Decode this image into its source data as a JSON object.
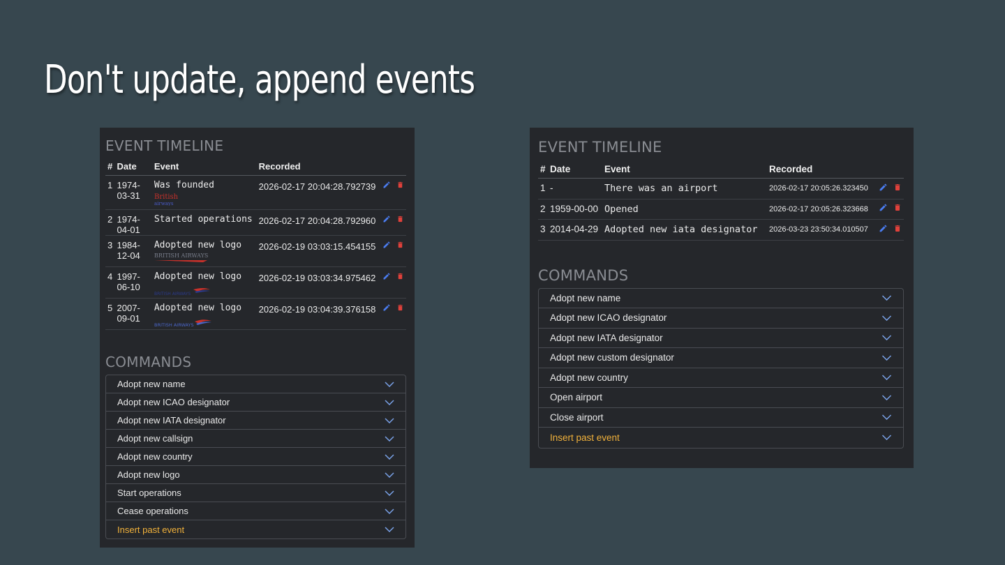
{
  "slide": {
    "title": "Don't update, append events"
  },
  "left_panel": {
    "timeline_heading": "EVENT TIMELINE",
    "columns": {
      "num": "#",
      "date": "Date",
      "event": "Event",
      "recorded": "Recorded"
    },
    "rows": [
      {
        "num": "1",
        "date": "1974-03-31",
        "event": "Was founded",
        "recorded": "2026-02-17 20:04:28.792739",
        "logo": "British airways",
        "logo_word1": "British",
        "logo_word2": "airways"
      },
      {
        "num": "2",
        "date": "1974-04-01",
        "event": "Started operations",
        "recorded": "2026-02-17 20:04:28.792960"
      },
      {
        "num": "3",
        "date": "1984-12-04",
        "event": "Adopted new logo",
        "recorded": "2026-02-19 03:03:15.454155",
        "logo": "BRITISH AIRWAYS"
      },
      {
        "num": "4",
        "date": "1997-06-10",
        "event": "Adopted new logo",
        "recorded": "2026-02-19 03:03:34.975462",
        "logo": "BRITISH AIRWAYS"
      },
      {
        "num": "5",
        "date": "2007-09-01",
        "event": "Adopted new logo",
        "recorded": "2026-02-19 03:04:39.376158",
        "logo": "BRITISH AIRWAYS"
      }
    ],
    "commands_heading": "COMMANDS",
    "commands": [
      {
        "label": "Adopt new name"
      },
      {
        "label": "Adopt new ICAO designator"
      },
      {
        "label": "Adopt new IATA designator"
      },
      {
        "label": "Adopt new callsign"
      },
      {
        "label": "Adopt new country"
      },
      {
        "label": "Adopt new logo"
      },
      {
        "label": "Start operations"
      },
      {
        "label": "Cease operations"
      },
      {
        "label": "Insert past event"
      }
    ]
  },
  "right_panel": {
    "timeline_heading": "EVENT TIMELINE",
    "columns": {
      "num": "#",
      "date": "Date",
      "event": "Event",
      "recorded": "Recorded"
    },
    "rows": [
      {
        "num": "1",
        "date": "-",
        "event": "There was an airport",
        "recorded": "2026-02-17 20:05:26.323450"
      },
      {
        "num": "2",
        "date": "1959-00-00",
        "event": "Opened",
        "recorded": "2026-02-17 20:05:26.323668"
      },
      {
        "num": "3",
        "date": "2014-04-29",
        "event": "Adopted new iata designator",
        "recorded": "2026-03-23 23:50:34.010507"
      }
    ],
    "commands_heading": "COMMANDS",
    "commands": [
      {
        "label": "Adopt new name"
      },
      {
        "label": "Adopt new ICAO designator"
      },
      {
        "label": "Adopt new IATA designator"
      },
      {
        "label": "Adopt new custom designator"
      },
      {
        "label": "Adopt new country"
      },
      {
        "label": "Open airport"
      },
      {
        "label": "Close airport"
      },
      {
        "label": "Insert past event"
      }
    ]
  },
  "colors": {
    "background": "#37474f",
    "panel": "#25272b",
    "edit_icon": "#4a7cf0",
    "delete_icon": "#e0413b",
    "highlight_command": "#f2b23b"
  },
  "icons": {
    "edit": "pencil-icon",
    "delete": "trash-icon",
    "expand": "chevron-down-icon"
  }
}
